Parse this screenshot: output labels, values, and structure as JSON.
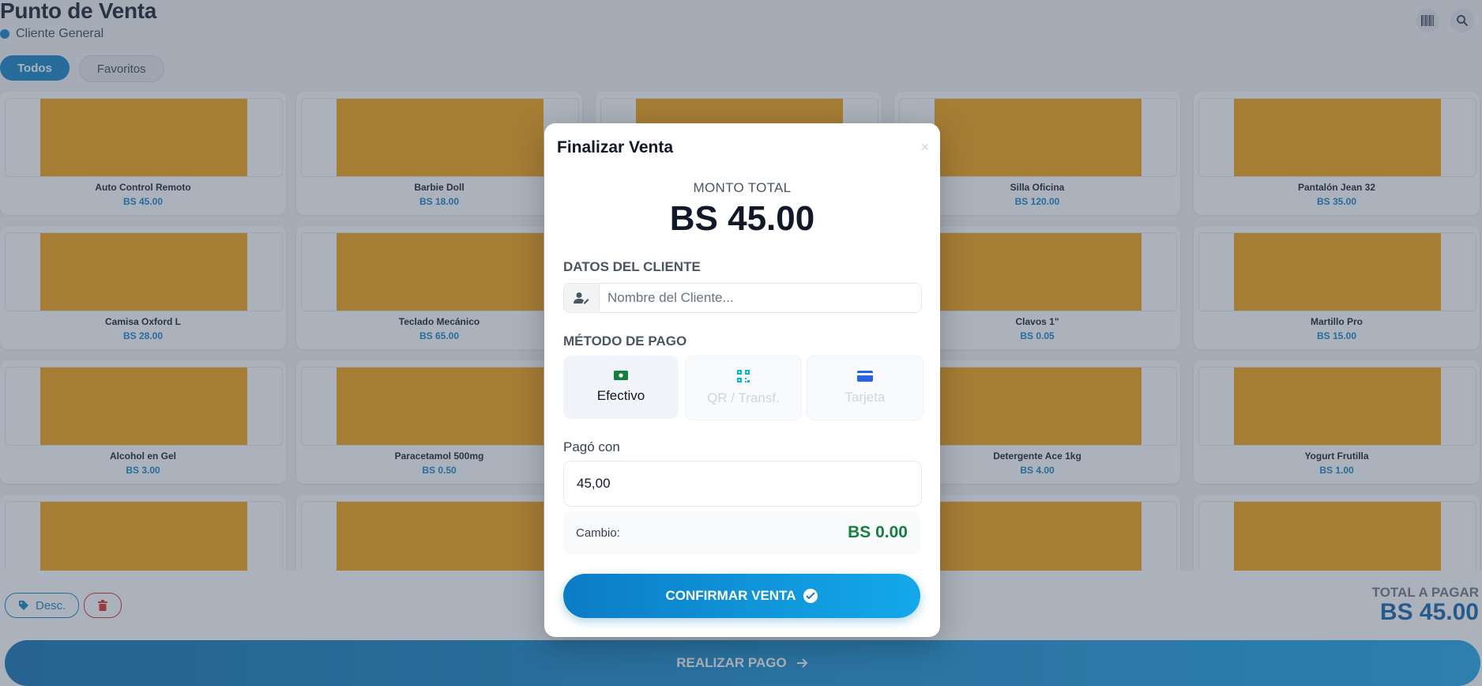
{
  "header": {
    "title": "Punto de Venta",
    "client": "Cliente General"
  },
  "tabs": [
    {
      "label": "Todos",
      "active": true
    },
    {
      "label": "Favoritos",
      "active": false
    }
  ],
  "top_icons": [
    "barcode-icon",
    "search-icon"
  ],
  "products": [
    {
      "name": "Auto Control Remoto",
      "price": "BS 45.00"
    },
    {
      "name": "Barbie Doll",
      "price": "BS 18.00"
    },
    {
      "name": "",
      "price": ""
    },
    {
      "name": "Silla Oficina",
      "price": "BS 120.00"
    },
    {
      "name": "Pantalón Jean 32",
      "price": "BS 35.00"
    },
    {
      "name": "Camisa Oxford L",
      "price": "BS 28.00"
    },
    {
      "name": "Teclado Mecánico",
      "price": "BS 65.00"
    },
    {
      "name": "",
      "price": ""
    },
    {
      "name": "Clavos 1\"",
      "price": "BS 0.05"
    },
    {
      "name": "Martillo Pro",
      "price": "BS 15.00"
    },
    {
      "name": "Alcohol en Gel",
      "price": "BS 3.00"
    },
    {
      "name": "Paracetamol 500mg",
      "price": "BS 0.50"
    },
    {
      "name": "",
      "price": ""
    },
    {
      "name": "Detergente Ace 1kg",
      "price": "BS 4.00"
    },
    {
      "name": "Yogurt Frutilla",
      "price": "BS 1.00"
    }
  ],
  "bottom": {
    "desc_label": "Desc.",
    "total_label": "TOTAL A PAGAR",
    "total_value": "BS 45.00",
    "pay_label": "REALIZAR PAGO"
  },
  "modal": {
    "title": "Finalizar Venta",
    "close": "×",
    "total_label": "MONTO TOTAL",
    "total_value": "BS 45.00",
    "client_section": "DATOS DEL CLIENTE",
    "client_placeholder": "Nombre del Cliente...",
    "payment_section": "MÉTODO DE PAGO",
    "methods": [
      {
        "label": "Efectivo",
        "icon": "cash-icon",
        "selected": true,
        "color": "#15803d"
      },
      {
        "label": "QR / Transf.",
        "icon": "qr-icon",
        "selected": false,
        "color": "#06b6d4"
      },
      {
        "label": "Tarjeta",
        "icon": "credit-card-icon",
        "selected": false,
        "color": "#2563eb"
      }
    ],
    "paid_label": "Pagó con",
    "paid_value": "45,00",
    "change_label": "Cambio:",
    "change_value": "BS 0.00",
    "confirm_label": "CONFIRMAR VENTA"
  },
  "colors": {
    "accent": "#0e7fc4",
    "product_placeholder": "#f59e0b",
    "change": "#15803d",
    "danger": "#dc2626"
  }
}
